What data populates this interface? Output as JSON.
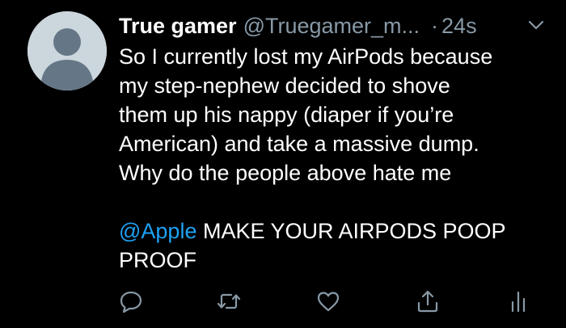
{
  "tweet": {
    "author": {
      "display_name": "True gamer",
      "handle": "@Truegamer_m...",
      "avatar_icon": "default-profile-icon"
    },
    "separator": "·",
    "timestamp": "24s",
    "menu_icon": "chevron-down-icon",
    "text_lines": [
      "So I currently lost my AirPods because",
      "my step-nephew decided to shove",
      "them up his nappy (diaper if you’re",
      "American) and take a massive dump.",
      "Why do the people above hate me"
    ],
    "mention": "@Apple",
    "mention_text_rest": " MAKE YOUR AIRPODS POOP",
    "last_line": "PROOF",
    "actions": {
      "reply_icon": "reply-icon",
      "retweet_icon": "retweet-icon",
      "like_icon": "heart-icon",
      "share_icon": "share-icon",
      "analytics_icon": "analytics-icon"
    }
  },
  "colors": {
    "background": "#000000",
    "text": "#ffffff",
    "secondary": "#8899a6",
    "link": "#1da1f2",
    "avatar_bg": "#ccd6dd",
    "avatar_fg": "#657786"
  }
}
